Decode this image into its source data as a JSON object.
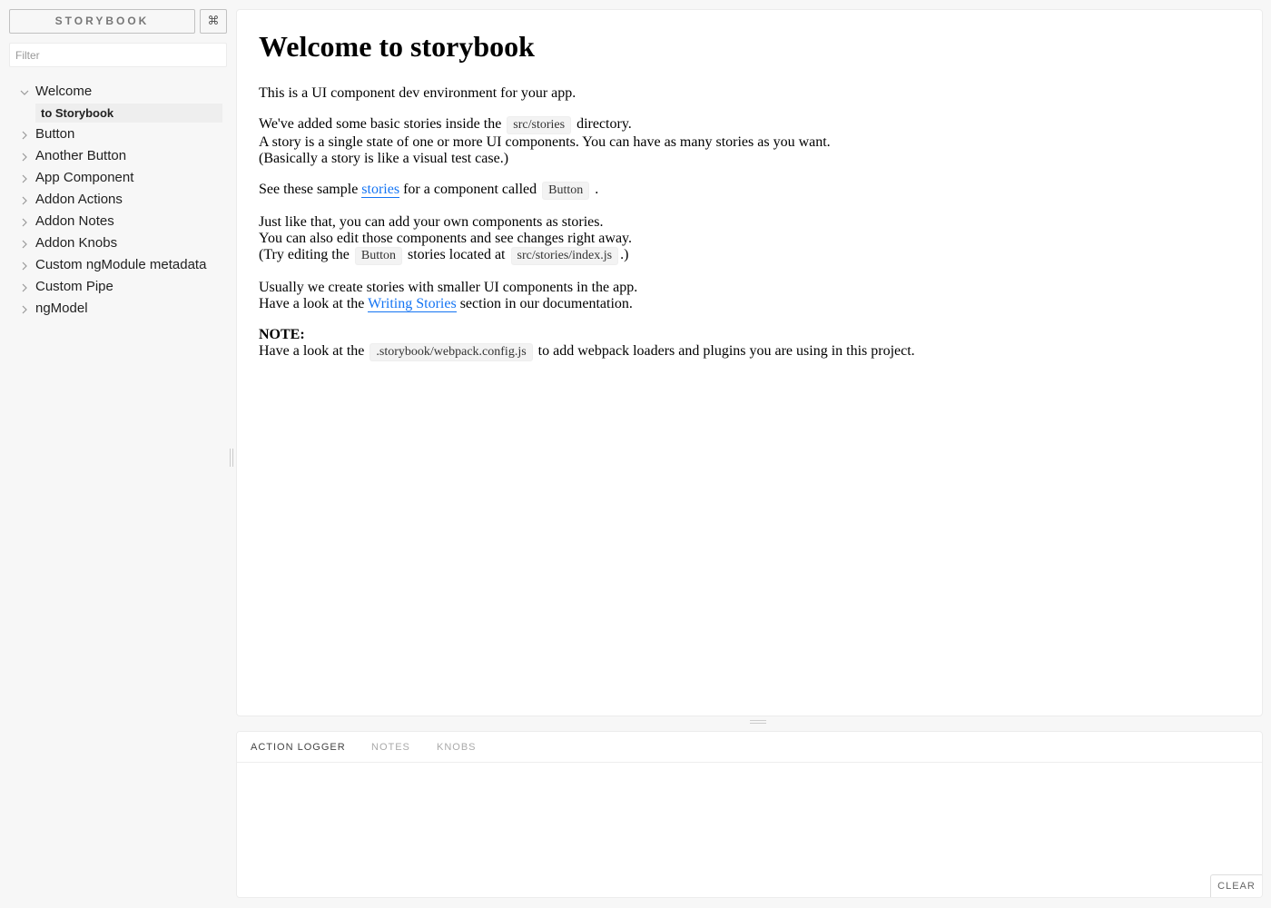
{
  "sidebar": {
    "brand": "STORYBOOK",
    "shortcut_icon": "⌘",
    "filter_placeholder": "Filter",
    "kinds": [
      {
        "label": "Welcome",
        "expanded": true,
        "stories": [
          "to Storybook"
        ]
      },
      {
        "label": "Button",
        "expanded": false
      },
      {
        "label": "Another Button",
        "expanded": false
      },
      {
        "label": "App Component",
        "expanded": false
      },
      {
        "label": "Addon Actions",
        "expanded": false
      },
      {
        "label": "Addon Notes",
        "expanded": false
      },
      {
        "label": "Addon Knobs",
        "expanded": false
      },
      {
        "label": "Custom ngModule metadata",
        "expanded": false
      },
      {
        "label": "Custom Pipe",
        "expanded": false
      },
      {
        "label": "ngModel",
        "expanded": false
      }
    ]
  },
  "preview": {
    "title": "Welcome to storybook",
    "p1": "This is a UI component dev environment for your app.",
    "p2_a": "We've added some basic stories inside the",
    "p2_code": "src/stories",
    "p2_b": "directory.",
    "p2_line2": "A story is a single state of one or more UI components. You can have as many stories as you want.",
    "p2_line3": "(Basically a story is like a visual test case.)",
    "p3_a": "See these sample",
    "p3_link": "stories",
    "p3_b": "for a component called",
    "p3_code": "Button",
    "p3_c": ".",
    "p4_line1": "Just like that, you can add your own components as stories.",
    "p4_line2": "You can also edit those components and see changes right away.",
    "p4_line3_a": "(Try editing the",
    "p4_line3_code1": "Button",
    "p4_line3_b": "stories located at",
    "p4_line3_code2": "src/stories/index.js",
    "p4_line3_c": ".)",
    "p5_line1": "Usually we create stories with smaller UI components in the app.",
    "p5_line2_a": "Have a look at the",
    "p5_line2_link": "Writing Stories",
    "p5_line2_b": "section in our documentation.",
    "note_label": "NOTE:",
    "note_a": "Have a look at the",
    "note_code": ".storybook/webpack.config.js",
    "note_b": "to add webpack loaders and plugins you are using in this project."
  },
  "addons": {
    "tabs": [
      "Action Logger",
      "Notes",
      "Knobs"
    ],
    "active_tab": 0,
    "clear_label": "CLEAR"
  },
  "colors": {
    "link": "#1474f3",
    "sidebar_bg": "#f7f7f7",
    "selected_story_bg": "#eeeeee"
  }
}
